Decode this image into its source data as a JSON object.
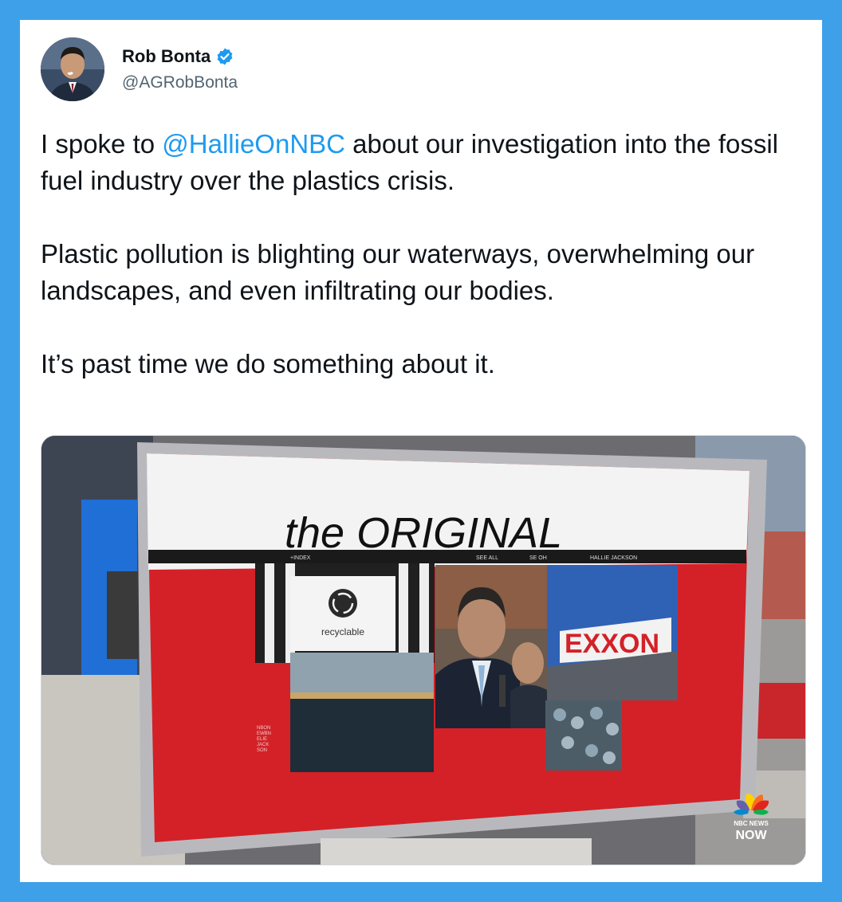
{
  "author": {
    "display_name": "Rob Bonta",
    "handle": "@AGRobBonta",
    "verified": true,
    "avatar_icon": "profile-photo"
  },
  "tweet": {
    "text_before_mention": "I spoke to ",
    "mention": "@HallieOnNBC",
    "text_after_mention": " about our investigation into the fossil fuel industry over the plastics crisis.\n\nPlastic pollution is blighting our waterways, overwhelming our landscapes, and even infiltrating our bodies.\n\nIt’s past time we do something about it."
  },
  "media": {
    "screen_title": "the ORIGINAL",
    "nav_index": "+INDEX",
    "nav_see_all": "SEE ALL",
    "nav_show": "SE  OH",
    "nav_host": "HALLIE JACKSON",
    "recycle_label": "recyclable",
    "exxon_label": "EXXON",
    "side_text": "NBON\nEWBN\nELIE\nJACK\nSON",
    "network_logo_line1": "NBC NEWS",
    "network_logo_line2": "NOW"
  },
  "colors": {
    "background": "#3fa0ea",
    "mention": "#1d9bf0",
    "verified": "#1d9bf0",
    "screen_red": "#d32127"
  }
}
